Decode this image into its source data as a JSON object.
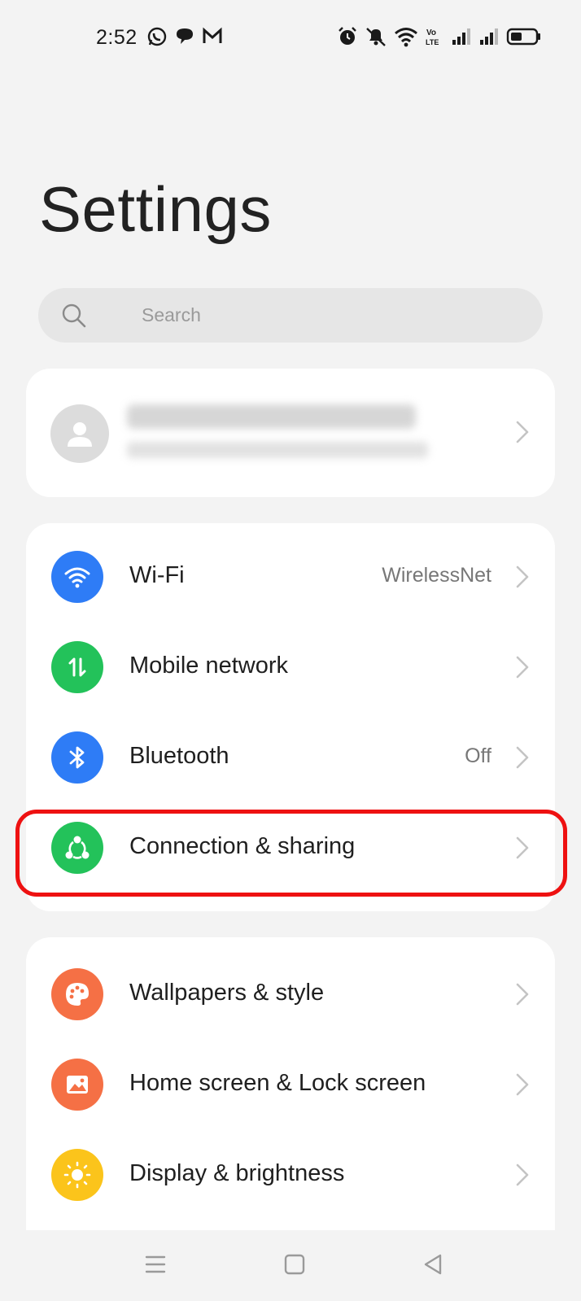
{
  "status_bar": {
    "time": "2:52",
    "left_icons": [
      "whatsapp-icon",
      "chat-icon",
      "gmail-icon"
    ],
    "right_icons": [
      "alarm-icon",
      "mute-icon",
      "wifi-signal-icon",
      "volte-icon",
      "cell-signal-icon",
      "cell-signal-icon",
      "battery-icon"
    ]
  },
  "header": {
    "title": "Settings"
  },
  "search": {
    "placeholder": "Search"
  },
  "account": {
    "name": "",
    "subtitle": ""
  },
  "connect_section": {
    "items": [
      {
        "label": "Wi-Fi",
        "value": "WirelessNet",
        "icon": "wifi-icon",
        "color": "#2e7cf6"
      },
      {
        "label": "Mobile network",
        "value": "",
        "icon": "mobile-data-icon",
        "color": "#23c25a"
      },
      {
        "label": "Bluetooth",
        "value": "Off",
        "icon": "bluetooth-icon",
        "color": "#2e7cf6"
      },
      {
        "label": "Connection & sharing",
        "value": "",
        "icon": "share-icon",
        "color": "#23c25a"
      }
    ]
  },
  "style_section": {
    "items": [
      {
        "label": "Wallpapers & style",
        "value": "",
        "icon": "palette-icon",
        "color": "#f57045"
      },
      {
        "label": "Home screen & Lock screen",
        "value": "",
        "icon": "picture-icon",
        "color": "#f57045"
      },
      {
        "label": "Display & brightness",
        "value": "",
        "icon": "sun-icon",
        "color": "#fbc41b"
      }
    ]
  },
  "highlight_color": "#ee1111",
  "nav_bar": {
    "buttons": [
      "menu-icon",
      "home-icon",
      "back-icon"
    ]
  }
}
